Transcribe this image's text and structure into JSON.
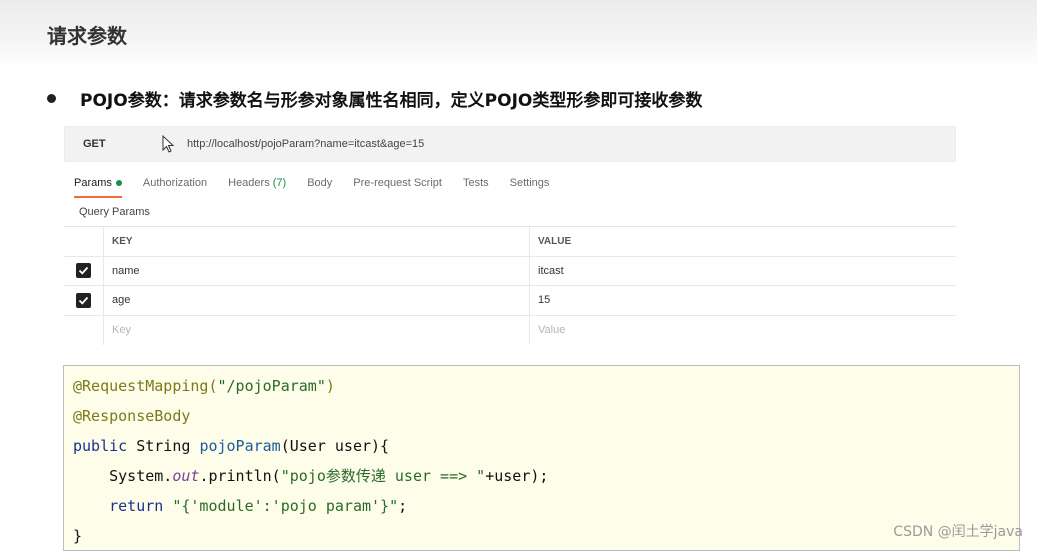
{
  "slide": {
    "title": "请求参数",
    "bullet": "POJO参数：请求参数名与形参对象属性名相同，定义POJO类型形参即可接收参数"
  },
  "request": {
    "method": "GET",
    "url": "http://localhost/pojoParam?name=itcast&age=15",
    "tabs": [
      {
        "label": "Params",
        "active": true
      },
      {
        "label": "Authorization"
      },
      {
        "label": "Headers",
        "count": "(7)"
      },
      {
        "label": "Body"
      },
      {
        "label": "Pre-request Script"
      },
      {
        "label": "Tests"
      },
      {
        "label": "Settings"
      }
    ],
    "section_label": "Query Params",
    "columns": {
      "key": "KEY",
      "value": "VALUE"
    },
    "rows": [
      {
        "key": "name",
        "value": "itcast",
        "checked": true
      },
      {
        "key": "age",
        "value": "15",
        "checked": true
      }
    ],
    "placeholder": {
      "key": "Key",
      "value": "Value"
    }
  },
  "code": {
    "line1": {
      "anno": "@RequestMapping(",
      "str": "\"/pojoParam\"",
      "tail": ")"
    },
    "line2": {
      "anno": "@ResponseBody"
    },
    "line3": {
      "kw": "public ",
      "type": "String ",
      "fn": "pojoParam",
      "tail": "(User user){"
    },
    "line4": {
      "pre": "    System.",
      "fld": "out",
      "mid": ".println(",
      "str": "\"pojo参数传递 user ==> \"",
      "tail": "+user);"
    },
    "line5": {
      "kw": "    return ",
      "str": "\"{'module':'pojo param'}\"",
      "tail": ";"
    },
    "line6": {
      "tail": "}"
    }
  },
  "watermark": "CSDN @闰土学java"
}
